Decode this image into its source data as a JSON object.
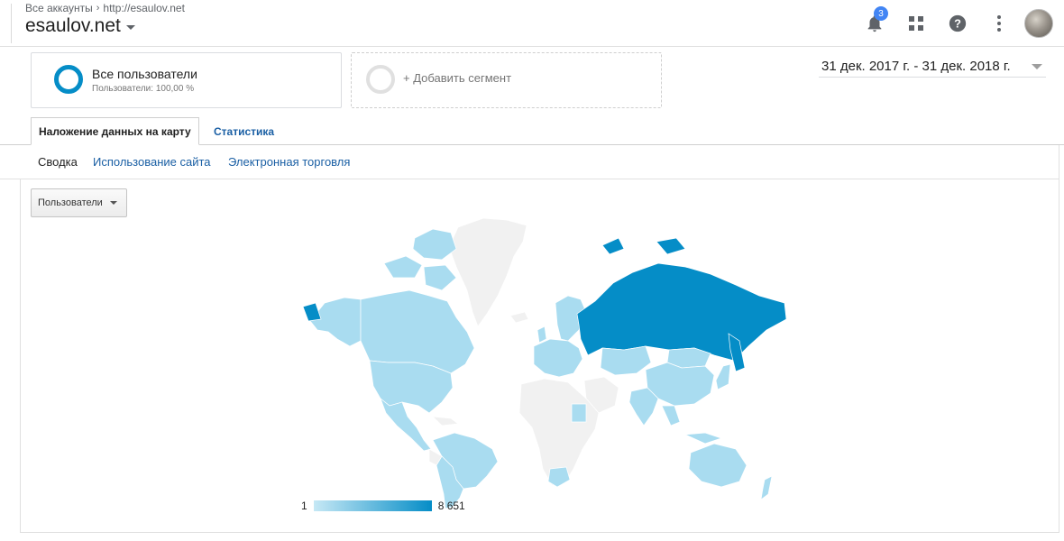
{
  "header": {
    "breadcrumb": [
      "Все аккаунты",
      "http://esaulov.net"
    ],
    "property_name": "esaulov.net",
    "notification_count": "3",
    "icons": [
      "bell-icon",
      "apps-grid-icon",
      "help-icon",
      "more-vert-icon",
      "avatar"
    ]
  },
  "segments": {
    "active": {
      "title": "Все пользователи",
      "subtitle": "Пользователи: 100,00 %"
    },
    "add_label": "+ Добавить сегмент"
  },
  "date_range": "31 дек. 2017 г. - 31 дек. 2018 г.",
  "tabs": [
    {
      "label": "Наложение данных на карту",
      "active": true
    },
    {
      "label": "Статистика",
      "active": false
    }
  ],
  "subnav": [
    {
      "label": "Сводка",
      "active": true
    },
    {
      "label": "Использование сайта",
      "active": false
    },
    {
      "label": "Электронная торговля",
      "active": false
    }
  ],
  "metric_select": "Пользователи",
  "map": {
    "legend_min": "1",
    "legend_max": "8 651",
    "colors": {
      "low": "#c6e8f5",
      "mid": "#a9dcf0",
      "high": "#058dc7",
      "none": "#f1f1f1"
    }
  }
}
